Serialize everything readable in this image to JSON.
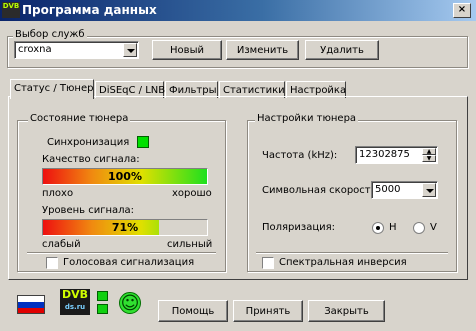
{
  "window": {
    "title": "Программа данных",
    "logo_text": "DVB",
    "close_label": "×"
  },
  "service": {
    "group_label": "Выбор служб",
    "selected": "croxna",
    "buttons": {
      "new": "Новый",
      "edit": "Изменить",
      "delete": "Удалить"
    }
  },
  "tabs": [
    {
      "label": "Статус / Тюнер",
      "active": true
    },
    {
      "label": "DiSEqC / LNB",
      "active": false
    },
    {
      "label": "Фильтры",
      "active": false
    },
    {
      "label": "Статистики",
      "active": false
    },
    {
      "label": "Настройка",
      "active": false
    }
  ],
  "tuner_status": {
    "group_label": "Состояние тюнера",
    "sync_label": "Синхронизация",
    "sync_color": "#00e000",
    "quality": {
      "label": "Качество сигнала:",
      "value": 100,
      "text": "100%",
      "low": "плохо",
      "high": "хорошо"
    },
    "level": {
      "label": "Уровень сигнала:",
      "value": 71,
      "text": "71%",
      "low": "слабый",
      "high": "сильный"
    },
    "voice_label": "Голосовая сигнализация",
    "voice_checked": false
  },
  "tuner_settings": {
    "group_label": "Настройки тюнера",
    "freq_label": "Частота (kHz):",
    "freq_value": "12302875",
    "symbol_label": "Символьная скорость",
    "symbol_value": "5000",
    "polar_label": "Поляризация:",
    "polar_h": "H",
    "polar_v": "V",
    "polar_selected": "H",
    "inversion_label": "Спектральная инверсия",
    "inversion_checked": false
  },
  "footer": {
    "logo_text": "DVB",
    "logo_sub": "ds.ru",
    "smiley": "☺",
    "buttons": {
      "help": "Помощь",
      "apply": "Принять",
      "close": "Закрыть"
    }
  },
  "colors": {
    "bar_red": "#ee1010",
    "bar_orange": "#f08a10",
    "bar_yellow": "#e0e000",
    "bar_green": "#1ee01e",
    "accent": "#0a246a"
  }
}
